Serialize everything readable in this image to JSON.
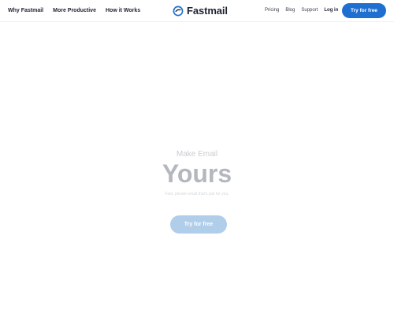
{
  "nav": {
    "left": [
      "Why Fastmail",
      "More Productive",
      "How it Works"
    ],
    "brand": "Fastmail",
    "right": [
      "Pricing",
      "Blog",
      "Support"
    ],
    "login": "Log in",
    "cta": "Try for free"
  },
  "hero": {
    "eyebrow": "Make Email",
    "headline": "Yours",
    "subtext": "Fast, private email that's just for you.",
    "cta": "Try for free"
  },
  "colors": {
    "accent": "#1f6fd0",
    "faded_accent": "#b0cdea"
  }
}
